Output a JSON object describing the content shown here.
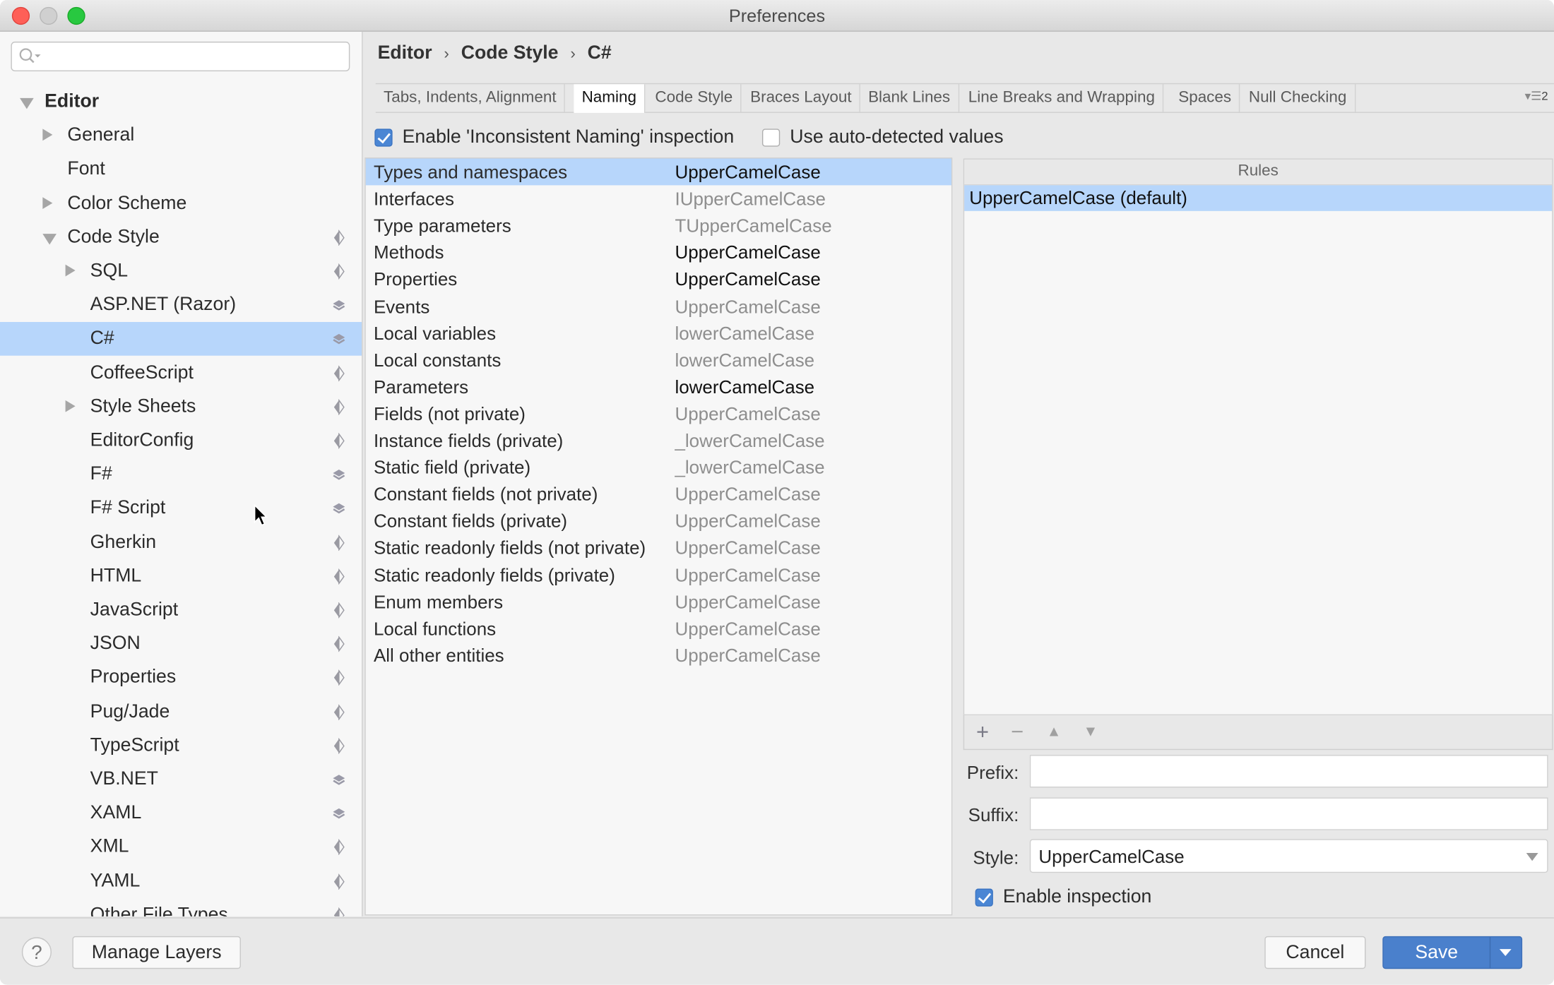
{
  "window": {
    "title": "Preferences"
  },
  "search": {
    "placeholder": ""
  },
  "sidebar": {
    "items": [
      {
        "label": "Editor",
        "level": 0,
        "expander": "down",
        "bold": true,
        "icon": ""
      },
      {
        "label": "General",
        "level": 1,
        "expander": "right",
        "icon": ""
      },
      {
        "label": "Font",
        "level": 1,
        "expander": "",
        "icon": ""
      },
      {
        "label": "Color Scheme",
        "level": 1,
        "expander": "right",
        "icon": ""
      },
      {
        "label": "Code Style",
        "level": 1,
        "expander": "down",
        "icon": "diamond-icon"
      },
      {
        "label": "SQL",
        "level": 2,
        "expander": "right",
        "icon": "diamond-icon"
      },
      {
        "label": "ASP.NET (Razor)",
        "level": 2,
        "expander": "",
        "icon": "layers-icon"
      },
      {
        "label": "C#",
        "level": 2,
        "expander": "",
        "icon": "layers-icon",
        "selected": true
      },
      {
        "label": "CoffeeScript",
        "level": 2,
        "expander": "",
        "icon": "diamond-icon"
      },
      {
        "label": "Style Sheets",
        "level": 2,
        "expander": "right",
        "icon": "diamond-icon"
      },
      {
        "label": "EditorConfig",
        "level": 2,
        "expander": "",
        "icon": "diamond-icon"
      },
      {
        "label": "F#",
        "level": 2,
        "expander": "",
        "icon": "layers-icon"
      },
      {
        "label": "F# Script",
        "level": 2,
        "expander": "",
        "icon": "layers-icon"
      },
      {
        "label": "Gherkin",
        "level": 2,
        "expander": "",
        "icon": "diamond-icon"
      },
      {
        "label": "HTML",
        "level": 2,
        "expander": "",
        "icon": "diamond-icon"
      },
      {
        "label": "JavaScript",
        "level": 2,
        "expander": "",
        "icon": "diamond-icon"
      },
      {
        "label": "JSON",
        "level": 2,
        "expander": "",
        "icon": "diamond-icon"
      },
      {
        "label": "Properties",
        "level": 2,
        "expander": "",
        "icon": "diamond-icon"
      },
      {
        "label": "Pug/Jade",
        "level": 2,
        "expander": "",
        "icon": "diamond-icon"
      },
      {
        "label": "TypeScript",
        "level": 2,
        "expander": "",
        "icon": "diamond-icon"
      },
      {
        "label": "VB.NET",
        "level": 2,
        "expander": "",
        "icon": "layers-icon"
      },
      {
        "label": "XAML",
        "level": 2,
        "expander": "",
        "icon": "layers-icon"
      },
      {
        "label": "XML",
        "level": 2,
        "expander": "",
        "icon": "diamond-icon"
      },
      {
        "label": "YAML",
        "level": 2,
        "expander": "",
        "icon": "diamond-icon"
      },
      {
        "label": "Other File Types",
        "level": 2,
        "expander": "",
        "icon": "diamond-icon"
      }
    ]
  },
  "breadcrumb": {
    "items": [
      "Editor",
      "Code Style",
      "C#"
    ],
    "separator": "›"
  },
  "tabs": {
    "items": [
      {
        "label": "Tabs, Indents, Alignment"
      },
      {
        "label": "Naming",
        "active": true
      },
      {
        "label": "Code Style"
      },
      {
        "label": "Braces Layout"
      },
      {
        "label": "Blank Lines"
      },
      {
        "label": "Line Breaks and Wrapping"
      },
      {
        "label": "Spaces"
      },
      {
        "label": "Null Checking"
      }
    ],
    "overflow_count": "2"
  },
  "options": {
    "enable_inconsistent_naming": {
      "label": "Enable 'Inconsistent Naming' inspection",
      "checked": true
    },
    "use_auto_detected": {
      "label": "Use auto-detected values",
      "checked": false
    }
  },
  "naming": {
    "rows": [
      {
        "kind": "Types and namespaces",
        "style": "UpperCamelCase",
        "emphasis": true,
        "selected": true
      },
      {
        "kind": "Interfaces",
        "style": "IUpperCamelCase",
        "emphasis": false
      },
      {
        "kind": "Type parameters",
        "style": "TUpperCamelCase",
        "emphasis": false
      },
      {
        "kind": "Methods",
        "style": "UpperCamelCase",
        "emphasis": true
      },
      {
        "kind": "Properties",
        "style": "UpperCamelCase",
        "emphasis": true
      },
      {
        "kind": "Events",
        "style": "UpperCamelCase",
        "emphasis": false
      },
      {
        "kind": "Local variables",
        "style": "lowerCamelCase",
        "emphasis": false
      },
      {
        "kind": "Local constants",
        "style": "lowerCamelCase",
        "emphasis": false
      },
      {
        "kind": "Parameters",
        "style": "lowerCamelCase",
        "emphasis": true
      },
      {
        "kind": "Fields (not private)",
        "style": "UpperCamelCase",
        "emphasis": false
      },
      {
        "kind": "Instance fields (private)",
        "style": "_lowerCamelCase",
        "emphasis": false
      },
      {
        "kind": "Static field (private)",
        "style": "_lowerCamelCase",
        "emphasis": false
      },
      {
        "kind": "Constant fields (not private)",
        "style": "UpperCamelCase",
        "emphasis": false
      },
      {
        "kind": "Constant fields (private)",
        "style": "UpperCamelCase",
        "emphasis": false
      },
      {
        "kind": "Static readonly fields (not private)",
        "style": "UpperCamelCase",
        "emphasis": false
      },
      {
        "kind": "Static readonly fields (private)",
        "style": "UpperCamelCase",
        "emphasis": false
      },
      {
        "kind": "Enum members",
        "style": "UpperCamelCase",
        "emphasis": false
      },
      {
        "kind": "Local functions",
        "style": "UpperCamelCase",
        "emphasis": false
      },
      {
        "kind": "All other entities",
        "style": "UpperCamelCase",
        "emphasis": false
      }
    ]
  },
  "rules": {
    "header": "Rules",
    "items": [
      {
        "label": "UpperCamelCase (default)",
        "selected": true
      }
    ],
    "toolbar": {
      "add": "+",
      "remove": "−",
      "up": "▲",
      "down": "▼"
    }
  },
  "rule_editor": {
    "prefix": {
      "label": "Prefix:",
      "value": ""
    },
    "suffix": {
      "label": "Suffix:",
      "value": ""
    },
    "style": {
      "label": "Style:",
      "value": "UpperCamelCase"
    },
    "enable_inspection": {
      "label": "Enable inspection",
      "checked": true
    }
  },
  "footer": {
    "help": "?",
    "manage_layers": "Manage Layers",
    "cancel": "Cancel",
    "save": "Save"
  },
  "colors": {
    "selection": "#b7d6fb",
    "primary_button": "#4a80cc",
    "checkbox": "#4a86d4"
  }
}
